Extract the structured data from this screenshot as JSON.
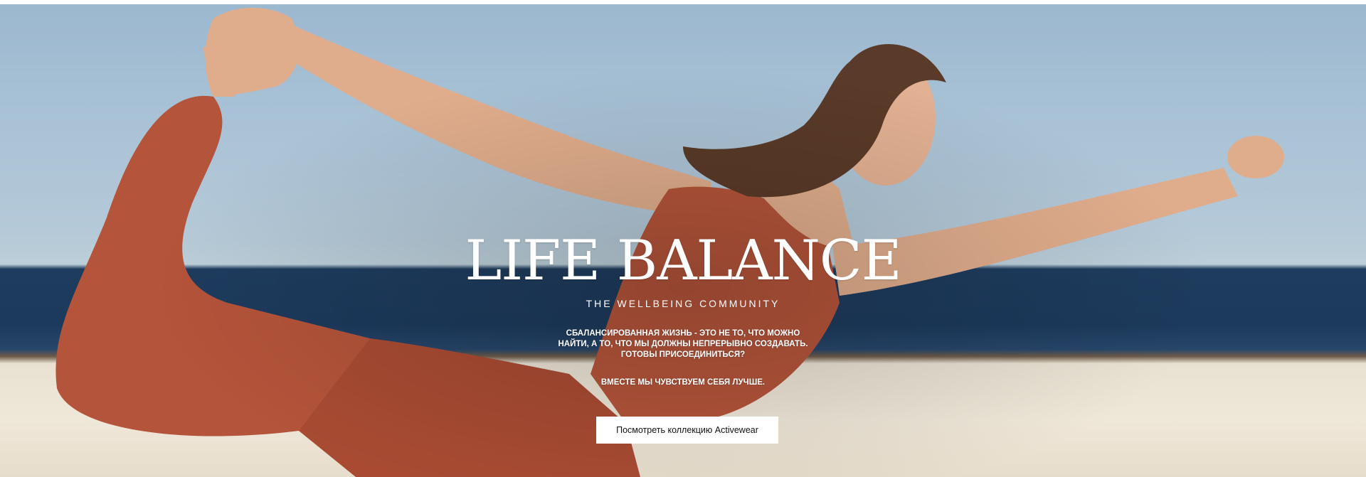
{
  "hero": {
    "logo_text": "LIFE BALANCE",
    "subtitle": "THE WELLBEING COMMUNITY",
    "body_line": "СБАЛАНСИРОВАННАЯ ЖИЗНЬ - ЭТО НЕ ТО, ЧТО МОЖНО НАЙТИ, А ТО, ЧТО МЫ ДОЛЖНЫ НЕПРЕРЫВНО СОЗДАВАТЬ. ГОТОВЫ ПРИСОЕДИНИТЬСЯ?",
    "body_line_2": "ВМЕСТЕ МЫ ЧУВСТВУЕМ СЕБЯ ЛУЧШЕ.",
    "cta_label": "Посмотреть коллекцию Activewear"
  },
  "colors": {
    "sky": "#a9c2d6",
    "sea": "#1e3c5e",
    "wall": "#efe7d8",
    "outfit": "#b4543a",
    "skin": "#e0ad8c",
    "hair": "#5a3a28",
    "button_bg": "#ffffff",
    "button_text": "#111111"
  }
}
